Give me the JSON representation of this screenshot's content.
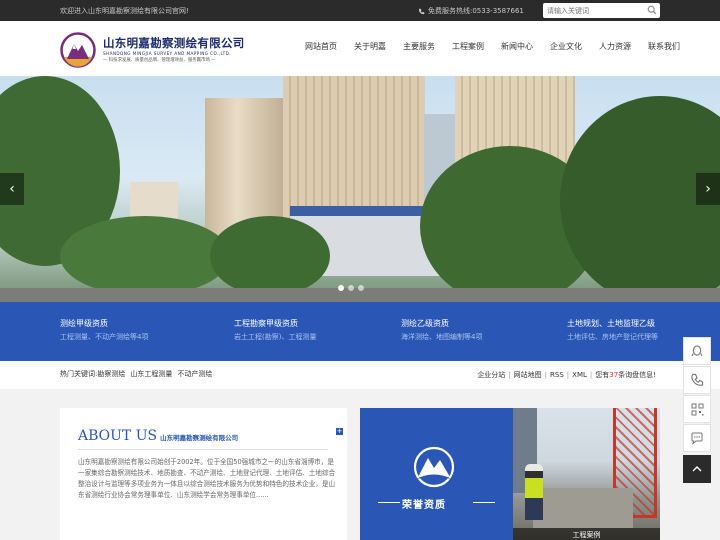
{
  "topbar": {
    "welcome": "欢迎进入山东明嘉勘察测绘有限公司官网!",
    "phone_label": "免费服务热线:0533-3587661",
    "search_placeholder": "请输入关键词"
  },
  "header": {
    "company_cn": "山东明嘉勘察测绘有限公司",
    "company_en": "SHANDONG MINGJIA SURVEY AND MAPPING CO.,LTD.",
    "slogan": "— 科技求发展、质量创品牌、管理增效益、服务赢市场 —"
  },
  "nav": [
    "网站首页",
    "关于明嘉",
    "主要服务",
    "工程案例",
    "新闻中心",
    "企业文化",
    "人力资源",
    "联系我们"
  ],
  "banner": {
    "prev": "‹",
    "next": "›"
  },
  "services": [
    {
      "title": "测绘甲级资质",
      "desc": "工程测量、不动产测绘等4项"
    },
    {
      "title": "工程勘察甲级资质",
      "desc": "岩土工程(勘察)、工程测量"
    },
    {
      "title": "测绘乙级资质",
      "desc": "海洋测绘、地图编制等4项"
    },
    {
      "title": "土地规划、土地监理乙级",
      "desc": "土地评估、房地产登记代理等"
    }
  ],
  "keywords": {
    "label": "热门关键词:",
    "items": [
      "勘察测绘",
      "山东工程测量",
      "不动产测绘"
    ],
    "links": [
      "企业分站",
      "网站地图",
      "RSS",
      "XML"
    ],
    "inquiry_prefix": "您有",
    "inquiry_count": "37",
    "inquiry_suffix": "条询盘信息!"
  },
  "about": {
    "heading": "ABOUT US",
    "subheading": "山东明嘉勘察测绘有限公司",
    "more": "+",
    "text": "山东明嘉勘察测绘有限公司始创于2002年。位于全国50强城市之一的山东省淄博市，是一家集综合勘察测绘技术、地质勘查、不动产测绘、土地登记代理、土地评估、土地综合整治设计与监理等多项业务为一体且以综合测绘技术服务为优势和特色的技术企业，是山东省测绘行业协会常务理事单位、山东测绘学会常务理事单位......"
  },
  "honor": {
    "title": "荣誉资质"
  },
  "cases": {
    "caption": "工程案例"
  }
}
